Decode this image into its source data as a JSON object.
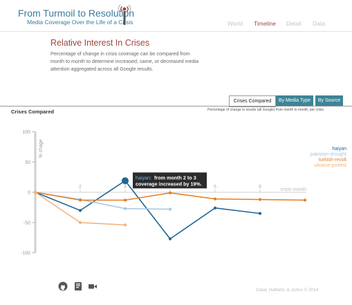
{
  "header": {
    "title": "From Turmoil to Resolution",
    "subtitle": "Media Coverage Over the Life of a Crisis",
    "nav": [
      {
        "label": "World",
        "active": false
      },
      {
        "label": "Timeline",
        "active": true
      },
      {
        "label": "Detail",
        "active": false
      },
      {
        "label": "Data",
        "active": false
      }
    ]
  },
  "section": {
    "title": "Relative Interest In Crises",
    "description": "Percentage of change in crisis coverage can be compared from month to month to determine increased, same, or decreased media attention aggregated across all Google results."
  },
  "tabs": [
    {
      "label": "Crises Compared",
      "active": true
    },
    {
      "label": "By Media Type",
      "active": false
    },
    {
      "label": "By Source",
      "active": false
    }
  ],
  "panel": {
    "title": "Crises Compared",
    "caption": "Percentage of change in results (all Google) from month to month, per crisis."
  },
  "chart_data": {
    "type": "line",
    "ylabel": "% chage",
    "xlabel": "crisis month",
    "ylim": [
      -100,
      100
    ],
    "yticks": [
      100,
      50,
      0,
      -50,
      -100
    ],
    "xticks": [
      2,
      3,
      4,
      5,
      6
    ],
    "grid": false,
    "legend_position": "right",
    "series": [
      {
        "name": "haiyan",
        "color": "#1f6796",
        "x": [
          1,
          2,
          3,
          4,
          5,
          6
        ],
        "values": [
          0,
          -30,
          19,
          -77,
          -26,
          -35
        ]
      },
      {
        "name": "pakistan-drought",
        "color": "#a9c6df",
        "x": [
          1,
          2,
          3,
          4
        ],
        "values": [
          0,
          -12,
          -27,
          -28
        ]
      },
      {
        "name": "turkish-revolt",
        "color": "#e67e22",
        "x": [
          1,
          2,
          3,
          4,
          5,
          6,
          7
        ],
        "values": [
          0,
          -13,
          -13,
          -1,
          -11,
          -12,
          -13
        ]
      },
      {
        "name": "ukraine-protest",
        "color": "#f5b27a",
        "x": [
          1,
          2,
          3
        ],
        "values": [
          0,
          -50,
          -54
        ]
      }
    ],
    "tooltip": {
      "series": "haiyan",
      "x": 3,
      "name_text": "haiyan:",
      "text_line1": "from month 2 to 3",
      "text_line2": "coverage increased by 19%."
    }
  },
  "footer": {
    "credit": "Datal, Hatfield, & Johns © 2014",
    "icons": [
      "github-icon",
      "document-icon",
      "video-icon"
    ]
  }
}
